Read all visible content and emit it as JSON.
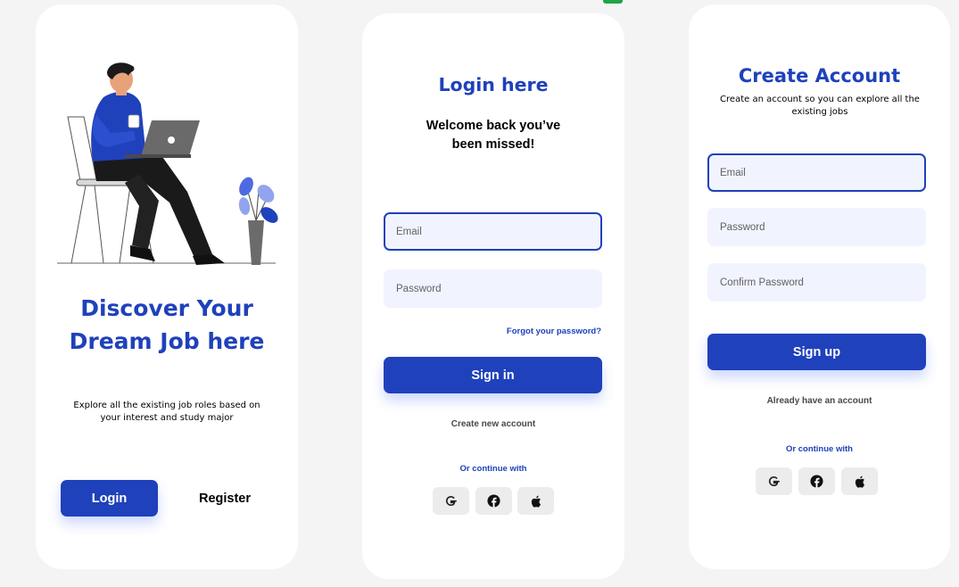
{
  "welcome": {
    "title_line1": "Discover Your",
    "title_line2": "Dream Job here",
    "subtitle": "Explore all the existing job roles based on your interest and study major",
    "login_label": "Login",
    "register_label": "Register"
  },
  "login": {
    "title": "Login here",
    "welcome_line1": "Welcome back you’ve",
    "welcome_line2": "been missed!",
    "email_placeholder": "Email",
    "password_placeholder": "Password",
    "forgot_label": "Forgot your password?",
    "signin_label": "Sign in",
    "create_account_label": "Create new account",
    "continue_with": "Or continue with"
  },
  "register": {
    "title": "Create Account",
    "subtitle": "Create an account so you can explore all the existing jobs",
    "email_placeholder": "Email",
    "password_placeholder": "Password",
    "confirm_placeholder": "Confirm Password",
    "signup_label": "Sign up",
    "have_account_label": "Already have an account",
    "continue_with": "Or continue with"
  },
  "social_icons": [
    "google-icon",
    "facebook-icon",
    "apple-icon"
  ],
  "colors": {
    "primary": "#1f41bb",
    "field_bg": "#f1f4ff",
    "social_bg": "#ececec",
    "page_bg": "#f4f4f4"
  }
}
